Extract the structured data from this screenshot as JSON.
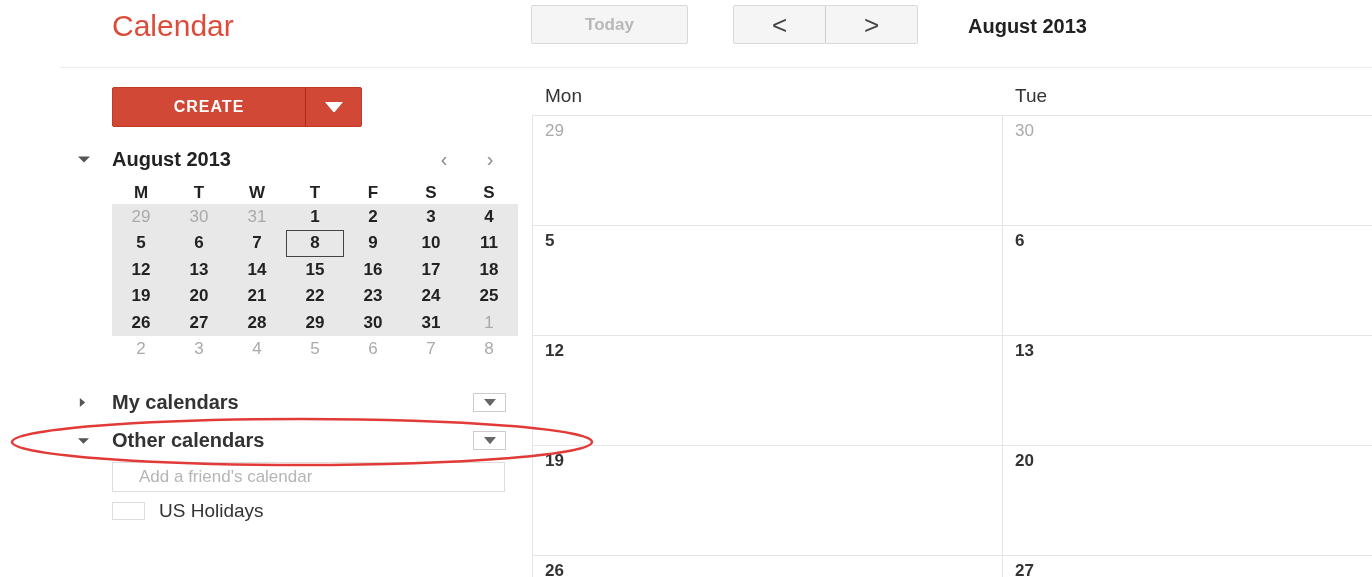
{
  "header": {
    "brand": "Calendar",
    "today_button": {
      "label": "Today",
      "disabled": true
    },
    "prev_button": "<",
    "next_button": ">",
    "period_title": "August 2013"
  },
  "create_button": {
    "label": "CREATE"
  },
  "mini_calendar": {
    "title": "August 2013",
    "expanded": true,
    "prev": "‹",
    "next": "›",
    "weekdays": [
      "M",
      "T",
      "W",
      "T",
      "F",
      "S",
      "S"
    ],
    "weeks": [
      {
        "in_view": true,
        "days": [
          {
            "label": "29",
            "muted": true,
            "today": false
          },
          {
            "label": "30",
            "muted": true,
            "today": false
          },
          {
            "label": "31",
            "muted": true,
            "today": false
          },
          {
            "label": "1",
            "muted": false,
            "today": false
          },
          {
            "label": "2",
            "muted": false,
            "today": false
          },
          {
            "label": "3",
            "muted": false,
            "today": false
          },
          {
            "label": "4",
            "muted": false,
            "today": false
          }
        ]
      },
      {
        "in_view": true,
        "days": [
          {
            "label": "5",
            "muted": false,
            "today": false
          },
          {
            "label": "6",
            "muted": false,
            "today": false
          },
          {
            "label": "7",
            "muted": false,
            "today": false
          },
          {
            "label": "8",
            "muted": false,
            "today": true
          },
          {
            "label": "9",
            "muted": false,
            "today": false
          },
          {
            "label": "10",
            "muted": false,
            "today": false
          },
          {
            "label": "11",
            "muted": false,
            "today": false
          }
        ]
      },
      {
        "in_view": true,
        "days": [
          {
            "label": "12",
            "muted": false,
            "today": false
          },
          {
            "label": "13",
            "muted": false,
            "today": false
          },
          {
            "label": "14",
            "muted": false,
            "today": false
          },
          {
            "label": "15",
            "muted": false,
            "today": false
          },
          {
            "label": "16",
            "muted": false,
            "today": false
          },
          {
            "label": "17",
            "muted": false,
            "today": false
          },
          {
            "label": "18",
            "muted": false,
            "today": false
          }
        ]
      },
      {
        "in_view": true,
        "days": [
          {
            "label": "19",
            "muted": false,
            "today": false
          },
          {
            "label": "20",
            "muted": false,
            "today": false
          },
          {
            "label": "21",
            "muted": false,
            "today": false
          },
          {
            "label": "22",
            "muted": false,
            "today": false
          },
          {
            "label": "23",
            "muted": false,
            "today": false
          },
          {
            "label": "24",
            "muted": false,
            "today": false
          },
          {
            "label": "25",
            "muted": false,
            "today": false
          }
        ]
      },
      {
        "in_view": true,
        "days": [
          {
            "label": "26",
            "muted": false,
            "today": false
          },
          {
            "label": "27",
            "muted": false,
            "today": false
          },
          {
            "label": "28",
            "muted": false,
            "today": false
          },
          {
            "label": "29",
            "muted": false,
            "today": false
          },
          {
            "label": "30",
            "muted": false,
            "today": false
          },
          {
            "label": "31",
            "muted": false,
            "today": false
          },
          {
            "label": "1",
            "muted": true,
            "today": false
          }
        ]
      },
      {
        "in_view": false,
        "days": [
          {
            "label": "2",
            "muted": true,
            "today": false
          },
          {
            "label": "3",
            "muted": true,
            "today": false
          },
          {
            "label": "4",
            "muted": true,
            "today": false
          },
          {
            "label": "5",
            "muted": true,
            "today": false
          },
          {
            "label": "6",
            "muted": true,
            "today": false
          },
          {
            "label": "7",
            "muted": true,
            "today": false
          },
          {
            "label": "8",
            "muted": true,
            "today": false
          }
        ]
      }
    ]
  },
  "sections": [
    {
      "title": "My calendars",
      "expanded": false
    },
    {
      "title": "Other calendars",
      "expanded": true,
      "add_field": {
        "placeholder": "Add a friend's calendar"
      },
      "calendars": [
        {
          "name": "US Holidays",
          "checked": false
        }
      ]
    }
  ],
  "month_view": {
    "columns": [
      "Mon",
      "Tue"
    ],
    "weeks": [
      [
        {
          "label": "29",
          "muted": true
        },
        {
          "label": "30",
          "muted": true
        }
      ],
      [
        {
          "label": "5",
          "muted": false
        },
        {
          "label": "6",
          "muted": false
        }
      ],
      [
        {
          "label": "12",
          "muted": false
        },
        {
          "label": "13",
          "muted": false
        }
      ],
      [
        {
          "label": "19",
          "muted": false
        },
        {
          "label": "20",
          "muted": false
        }
      ],
      [
        {
          "label": "26",
          "muted": false
        },
        {
          "label": "27",
          "muted": false
        }
      ]
    ]
  }
}
